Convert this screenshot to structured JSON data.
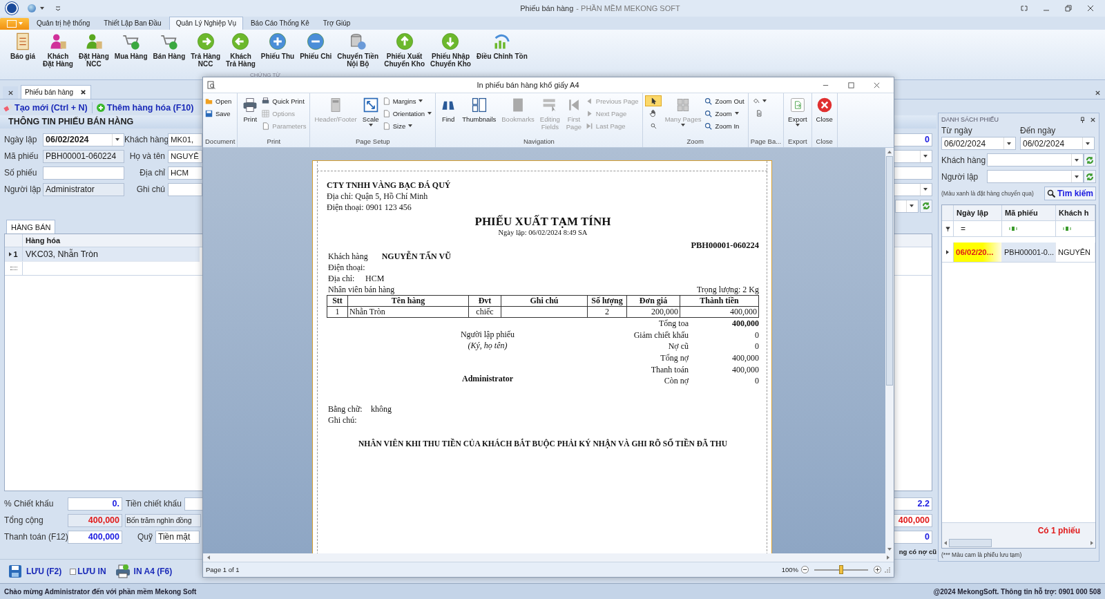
{
  "window": {
    "title": "Phiếu bán hàng",
    "subtitle": "- PHẦN MỀM MEKONG SOFT"
  },
  "ribbon_tabs": [
    {
      "label": "Quản trị hệ thống",
      "selected": false
    },
    {
      "label": "Thiết Lập Ban Đầu",
      "selected": false
    },
    {
      "label": "Quản Lý Nghiệp Vụ",
      "selected": true
    },
    {
      "label": "Báo Cáo Thống Kê",
      "selected": false
    },
    {
      "label": "Trợ Giúp",
      "selected": false
    }
  ],
  "ribbon_buttons": [
    [
      "Báo giá"
    ],
    [
      "Khách",
      "Đặt Hàng"
    ],
    [
      "Đặt Hàng",
      "NCC"
    ],
    [
      "Mua Hàng"
    ],
    [
      "Bán Hàng"
    ],
    [
      "Trả Hàng",
      "NCC"
    ],
    [
      "Khách",
      "Trả Hàng"
    ],
    [
      "Phiếu Thu"
    ],
    [
      "Phiếu Chi"
    ],
    [
      "Chuyển Tiền",
      "Nội Bộ"
    ],
    [
      "Phiếu Xuất",
      "Chuyển Kho"
    ],
    [
      "Phiếu Nhập",
      "Chuyển Kho"
    ],
    [
      "Điều Chỉnh Tồn"
    ]
  ],
  "ribbon_group": "CHỨNG TỪ",
  "doc_tabs": [
    {
      "label": "Phiếu bán hàng",
      "selected": true
    }
  ],
  "toolbar": [
    "Tạo mới (Ctrl + N)",
    "Thêm hàng hóa (F10)"
  ],
  "form": {
    "title": "THÔNG TIN PHIẾU BÁN HÀNG",
    "left": [
      {
        "label": "Ngày lập",
        "value": "06/02/2024",
        "kind": "date"
      },
      {
        "label": "Mã phiếu",
        "value": "PBH00001-060224",
        "kind": "readonly"
      },
      {
        "label": "Số phiếu",
        "kind": "text"
      },
      {
        "label": "Người lập",
        "value": "Administrator",
        "kind": "readonly"
      }
    ],
    "middle": [
      {
        "label": "Khách hàng",
        "value": "MK01,"
      },
      {
        "label": "Họ và tên",
        "value": "NGUYỄ"
      },
      {
        "label": "Địa chỉ",
        "value": "HCM"
      },
      {
        "label": "Ghi chú"
      }
    ],
    "right": [
      {
        "kind": "number",
        "value": "0"
      },
      {
        "kind": "dropdown"
      },
      {
        "kind": "text"
      },
      {
        "kind": "dropdown"
      },
      {
        "kind": "lookup"
      }
    ]
  },
  "grid": {
    "tab": "HÀNG BÁN",
    "columns": [
      "Hàng hóa"
    ],
    "rows": [
      {
        "number": "1",
        "cells": [
          "VKC03, Nhẫn Tròn"
        ],
        "selected": true
      }
    ]
  },
  "summary": {
    "discount_percent": {
      "label": "% Chiết khấu",
      "value": "0."
    },
    "discount_amount": {
      "label": "Tiền chiết khấu"
    },
    "total": {
      "label": "Tổng cộng",
      "value": "400,000",
      "in_words": "Bốn trăm nghìn đồng"
    },
    "paid": {
      "label": "Thanh toán (F12)",
      "value": "400,000"
    },
    "fund": {
      "label": "Quỹ",
      "value": "Tiền mặt"
    },
    "right_values": [
      "2.2",
      "400,000",
      "0"
    ],
    "right_note": "ng có nợ cũ"
  },
  "bottom_bar": {
    "save": "LƯU (F2)",
    "save_print": {
      "label": "LƯU IN",
      "checked": false
    },
    "print_a4": "IN A4 (F6)"
  },
  "status_bar": {
    "left": "Chào mừng Administrator đến với phần mềm Mekong Soft",
    "right": "@2024 MekongSoft. Thông tin hỗ trợ: 0901 000 508"
  },
  "list_panel": {
    "title": "DANH SÁCH PHIẾU",
    "from_label": "Từ ngày",
    "from_value": "06/02/2024",
    "to_label": "Đến ngày",
    "to_value": "06/02/2024",
    "customer_label": "Khách hàng",
    "creator_label": "Người lập",
    "hint": "(Màu xanh là đặt hàng chuyển qua)",
    "search": "Tìm kiếm",
    "columns": [
      "Ngày lập",
      "Mã phiếu",
      "Khách h"
    ],
    "filter": "=",
    "rows": [
      {
        "cells": [
          "06/02/20...",
          "PBH00001-0...",
          "NGUYỄN"
        ],
        "selected": true
      }
    ],
    "count": "Có 1 phiếu",
    "note": "(*** Màu cam là phiếu lưu tạm)"
  },
  "print_dialog": {
    "title": "In phiếu bán hàng khổ giấy A4",
    "groups": [
      {
        "label": "Document",
        "columns": [
          {
            "kind": "stack",
            "items": [
              {
                "label": "Open",
                "disabled": false
              },
              {
                "label": "Save",
                "disabled": false
              }
            ]
          }
        ]
      },
      {
        "label": "Print",
        "columns": [
          {
            "kind": "large",
            "label": [
              "Print"
            ],
            "disabled": false
          },
          {
            "kind": "stack",
            "items": [
              {
                "label": "Quick Print",
                "disabled": false
              },
              {
                "label": "Options",
                "disabled": true
              },
              {
                "label": "Parameters",
                "disabled": true
              }
            ]
          }
        ]
      },
      {
        "label": "Page Setup",
        "columns": [
          {
            "kind": "large",
            "label": [
              "Header/Footer"
            ],
            "disabled": true
          },
          {
            "kind": "large",
            "label": [
              "Scale"
            ],
            "disabled": false,
            "caret": true
          },
          {
            "kind": "stack",
            "items": [
              {
                "label": "Margins",
                "disabled": false,
                "caret": true
              },
              {
                "label": "Orientation",
                "disabled": false,
                "caret": true
              },
              {
                "label": "Size",
                "disabled": false,
                "caret": true
              }
            ]
          }
        ]
      },
      {
        "label": "Navigation",
        "columns": [
          {
            "kind": "large",
            "label": [
              "Find"
            ],
            "disabled": false
          },
          {
            "kind": "large",
            "label": [
              "Thumbnails"
            ],
            "disabled": false
          },
          {
            "kind": "large",
            "label": [
              "Bookmarks"
            ],
            "disabled": true
          },
          {
            "kind": "large",
            "label": [
              "Editing",
              "Fields"
            ],
            "disabled": true
          },
          {
            "kind": "large",
            "label": [
              "First",
              "Page"
            ],
            "disabled": true
          },
          {
            "kind": "stack",
            "items": [
              {
                "label": "Previous Page",
                "disabled": true
              },
              {
                "label": "Next Page",
                "disabled": true
              },
              {
                "label": "Last Page",
                "disabled": true
              }
            ]
          }
        ]
      },
      {
        "label": "Zoom",
        "columns": [
          {
            "kind": "tools",
            "items": [
              {
                "selected": true
              },
              {
                "selected": false
              },
              {
                "selected": false
              }
            ]
          },
          {
            "kind": "large",
            "label": [
              "Many Pages"
            ],
            "disabled": true,
            "caret": true
          },
          {
            "kind": "stack",
            "items": [
              {
                "label": "Zoom Out",
                "disabled": false
              },
              {
                "label": "Zoom",
                "disabled": false,
                "caret": true
              },
              {
                "label": "Zoom In",
                "disabled": false
              }
            ]
          }
        ]
      },
      {
        "label": "Page Ba...",
        "columns": [
          {
            "kind": "tools",
            "items": [
              {
                "selected": false,
                "caret": true
              },
              {
                "selected": false
              }
            ]
          }
        ]
      },
      {
        "label": "Export",
        "columns": [
          {
            "kind": "large",
            "label": [
              "Export"
            ],
            "disabled": false,
            "caret": true
          }
        ]
      },
      {
        "label": "Close",
        "columns": [
          {
            "kind": "large",
            "label": [
              "Close"
            ],
            "disabled": false
          }
        ]
      }
    ],
    "page_status": "Page 1 of 1",
    "zoom_text": "100%",
    "zoom": {
      "level": 0.5
    },
    "paper": {
      "company": "CTY TNHH VÀNG BẠC ĐÁ QUÝ",
      "address": "Địa chỉ: Quận 5, Hồ Chí Minh",
      "phone": "Điện thoại: 0901 123 456",
      "title": "PHIẾU XUẤT TẠM TÍNH",
      "date": "Ngày lập: 06/02/2024  8:49 SA",
      "code": "PBH00001-060224",
      "customer": {
        "label": "Khách hàng",
        "value": "NGUYỄN TẤN VŨ"
      },
      "customer_phone": {
        "label": "Điện thoại:"
      },
      "customer_address": {
        "label": "Địa chỉ:",
        "value": "HCM"
      },
      "salesperson": "Nhân viên bán hàng",
      "weight": "Trọng lượng: 2 Kg",
      "columns": [
        "Stt",
        "Tên hàng",
        "Đvt",
        "Ghi chú",
        "Số lượng",
        "Đơn giá",
        "Thành tiền"
      ],
      "rows": [
        [
          "1",
          "Nhẫn Tròn",
          "chiếc",
          null,
          "2",
          "200,000",
          "400,000"
        ]
      ],
      "signature": {
        "title": "Người lập phiếu",
        "hint": "(Ký, họ tên)",
        "name": "Administrator"
      },
      "totals": [
        {
          "label": "Tổng toa",
          "value": "400,000",
          "bold": true
        },
        {
          "label": "Giảm chiết khấu",
          "value": "0",
          "bold": false
        },
        {
          "label": "Nợ cũ",
          "value": "0",
          "bold": false
        },
        {
          "label": "Tổng nợ",
          "value": "400,000",
          "bold": false
        },
        {
          "label": "Thanh toán",
          "value": "400,000",
          "bold": false
        },
        {
          "label": "Còn nợ",
          "value": "0",
          "bold": false
        }
      ],
      "in_words": {
        "label": "Bằng chữ:",
        "value": "không"
      },
      "note": {
        "label": "Ghi chú:"
      },
      "footer": "NHÂN VIÊN KHI THU TIỀN CỦA KHÁCH BẮT BUỘC PHẢI KÝ NHẬN VÀ GHI RÕ SỐ TIỀN ĐÃ THU"
    }
  }
}
